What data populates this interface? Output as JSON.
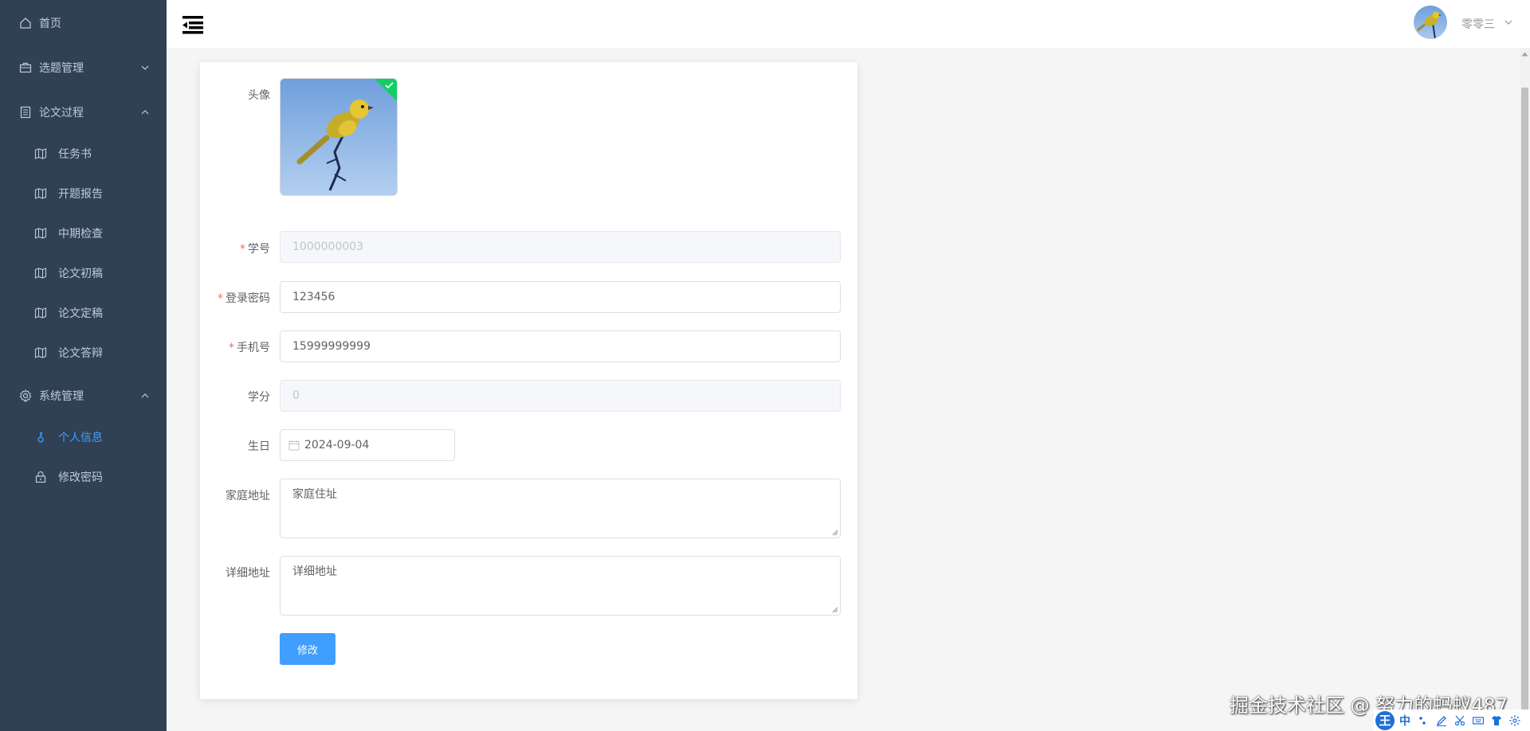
{
  "sidebar": {
    "items": [
      {
        "label": "首页",
        "icon": "home-icon"
      },
      {
        "label": "选题管理",
        "icon": "briefcase-icon",
        "expanded": false
      },
      {
        "label": "论文过程",
        "icon": "document-icon",
        "expanded": true,
        "children": [
          {
            "label": "任务书",
            "icon": "map-icon"
          },
          {
            "label": "开题报告",
            "icon": "map-icon"
          },
          {
            "label": "中期检查",
            "icon": "map-icon"
          },
          {
            "label": "论文初稿",
            "icon": "map-icon"
          },
          {
            "label": "论文定稿",
            "icon": "map-icon"
          },
          {
            "label": "论文答辩",
            "icon": "map-icon"
          }
        ]
      },
      {
        "label": "系统管理",
        "icon": "gear-icon",
        "expanded": true,
        "children": [
          {
            "label": "个人信息",
            "icon": "key-icon",
            "active": true
          },
          {
            "label": "修改密码",
            "icon": "lock-icon"
          }
        ]
      }
    ]
  },
  "header": {
    "user_name": "零零三"
  },
  "form": {
    "avatar_label": "头像",
    "student_id": {
      "label": "学号",
      "value": "1000000003",
      "required": true,
      "disabled": true
    },
    "password": {
      "label": "登录密码",
      "value": "123456",
      "required": true
    },
    "phone": {
      "label": "手机号",
      "value": "15999999999",
      "required": true
    },
    "credits": {
      "label": "学分",
      "value": "0",
      "disabled": true
    },
    "birthday": {
      "label": "生日",
      "value": "2024-09-04"
    },
    "home_address": {
      "label": "家庭地址",
      "value": "家庭住址"
    },
    "detail_address": {
      "label": "详细地址",
      "value": "详细地址"
    },
    "submit_label": "修改"
  },
  "watermark": "掘金技术社区 @ 努力的蚂蚁487",
  "ime": {
    "logo": "王",
    "mode": "中"
  },
  "colors": {
    "sidebar_bg": "#304156",
    "sidebar_text": "#bfcbd9",
    "active": "#409eff",
    "required": "#f56c6c",
    "success": "#13ce66"
  }
}
